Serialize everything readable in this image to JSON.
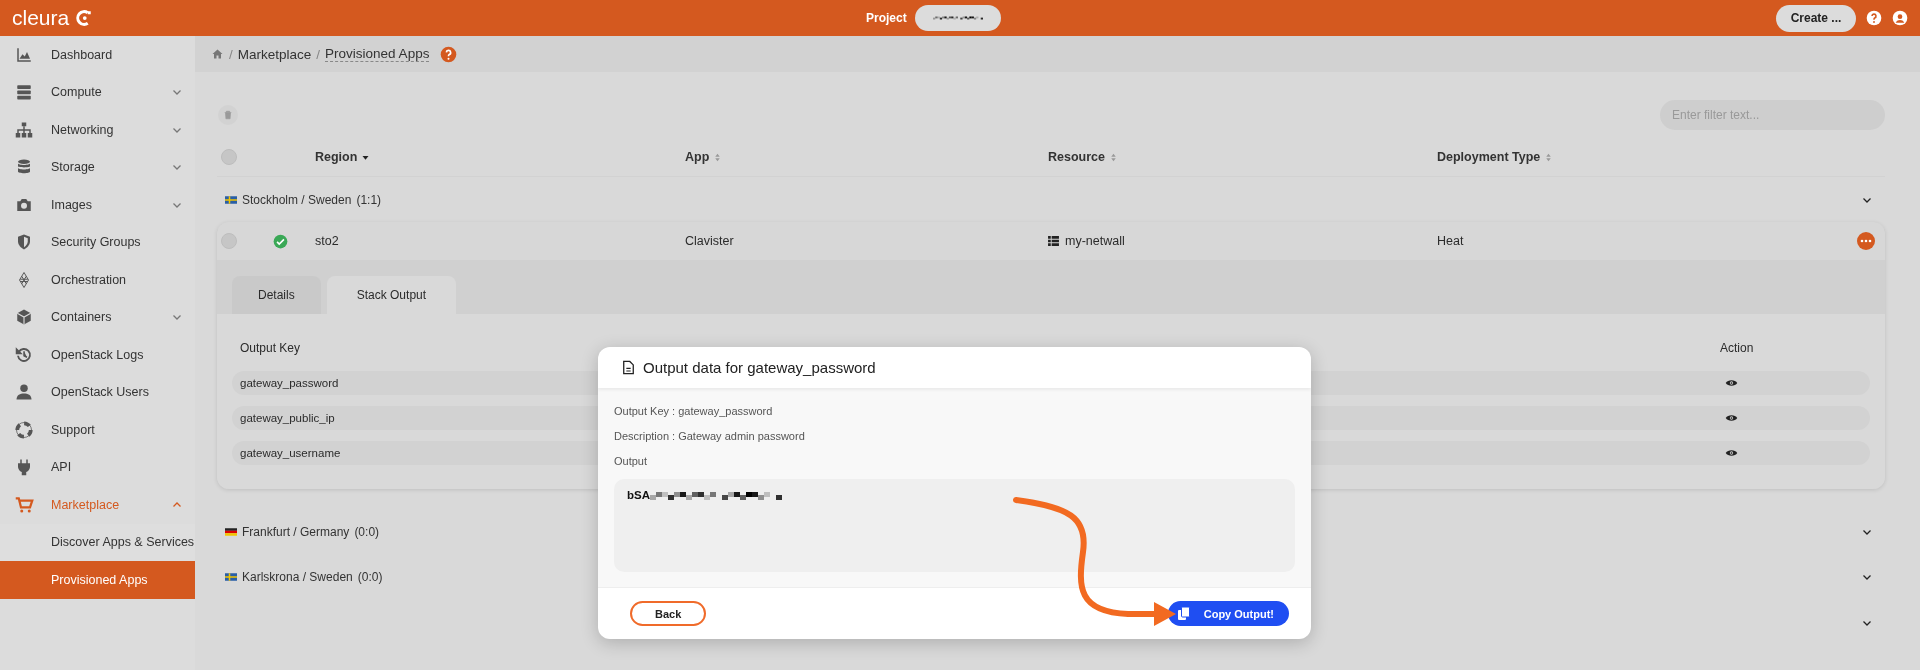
{
  "header": {
    "logo": "cleura",
    "project_label": "Project",
    "create_button": "Create ..."
  },
  "sidebar": {
    "items": [
      {
        "label": "Dashboard",
        "kind": "link",
        "selected": false
      },
      {
        "label": "Compute",
        "kind": "menu",
        "expanded": false,
        "selected": false
      },
      {
        "label": "Networking",
        "kind": "menu",
        "expanded": false,
        "selected": false
      },
      {
        "label": "Storage",
        "kind": "menu",
        "expanded": false,
        "selected": false
      },
      {
        "label": "Images",
        "kind": "menu",
        "expanded": false,
        "selected": false
      },
      {
        "label": "Security Groups",
        "kind": "link",
        "selected": false
      },
      {
        "label": "Orchestration",
        "kind": "link",
        "selected": false
      },
      {
        "label": "Containers",
        "kind": "menu",
        "expanded": false,
        "selected": false
      },
      {
        "label": "OpenStack Logs",
        "kind": "link",
        "selected": false
      },
      {
        "label": "OpenStack Users",
        "kind": "link",
        "selected": false
      },
      {
        "label": "Support",
        "kind": "link",
        "selected": false
      },
      {
        "label": "API",
        "kind": "link",
        "selected": false
      },
      {
        "label": "Marketplace",
        "kind": "menu",
        "expanded": true,
        "selected": true,
        "children": [
          {
            "label": "Discover Apps & Services",
            "selected": false
          },
          {
            "label": "Provisioned Apps",
            "selected": true
          }
        ]
      }
    ]
  },
  "breadcrumb": {
    "separator": "/",
    "items": [
      "Marketplace",
      "Provisioned Apps"
    ]
  },
  "filter": {
    "placeholder": "Enter filter text..."
  },
  "table": {
    "select_all_checked": false,
    "columns": [
      {
        "label": "Region",
        "sorted": true
      },
      {
        "label": "App",
        "sorted": false
      },
      {
        "label": "Resource",
        "sorted": false
      },
      {
        "label": "Deployment Type",
        "sorted": false
      }
    ],
    "groups": [
      {
        "name": "Stockholm / Sweden",
        "count": "(1:1)",
        "kind": "sweden",
        "rows": [
          {
            "selected": false,
            "healthy": true,
            "region": "sto2",
            "app": "Clavister",
            "resource": "my-netwall",
            "deployment_type": "Heat",
            "tabs": [
              {
                "label": "Details",
                "selected": false
              },
              {
                "label": "Stack Output",
                "selected": true
              }
            ],
            "outputs": {
              "columns": [
                "Output Key",
                "Action"
              ],
              "rows": [
                {
                  "key": "gateway_password"
                },
                {
                  "key": "gateway_public_ip"
                },
                {
                  "key": "gateway_username"
                }
              ]
            }
          }
        ]
      },
      {
        "name": "Frankfurt / Germany",
        "count": "(0:0)",
        "kind": "germany"
      },
      {
        "name": "Karlskrona / Sweden",
        "count": "(0:0)",
        "kind": "sweden"
      }
    ],
    "trailing_expander": true
  },
  "dialog": {
    "title": "Output data for gateway_password",
    "lines": [
      "Output Key : gateway_password",
      "Description : Gateway admin password"
    ],
    "output_label": "Output",
    "output_value": "bSA",
    "buttons": [
      {
        "label": "Back",
        "kind": "secondary"
      },
      {
        "label": "Copy Output!",
        "kind": "primary"
      }
    ]
  }
}
